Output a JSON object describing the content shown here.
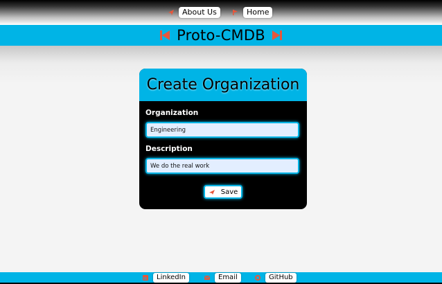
{
  "nav": {
    "about_label": "About Us",
    "home_label": "Home",
    "about_icon": "paper-plane-icon",
    "home_icon": "flag-icon"
  },
  "banner": {
    "title": "Proto-CMDB",
    "left_icon": "skip-back-icon",
    "right_icon": "skip-forward-icon"
  },
  "form": {
    "title": "Create Organization",
    "organization_label": "Organization",
    "organization_value": "Engineering",
    "description_label": "Description",
    "description_value": "We do the real work",
    "save_label": "Save",
    "save_icon": "paper-plane-icon"
  },
  "footer": {
    "linkedin_label": "LinkedIn",
    "email_label": "Email",
    "github_label": "GitHub",
    "linkedin_icon": "linkedin-icon",
    "email_icon": "email-icon",
    "github_icon": "github-icon"
  },
  "colors": {
    "accent": "#00b4e6",
    "icon": "#e8563a",
    "card": "#000000",
    "input_bg": "#e3eeff"
  }
}
